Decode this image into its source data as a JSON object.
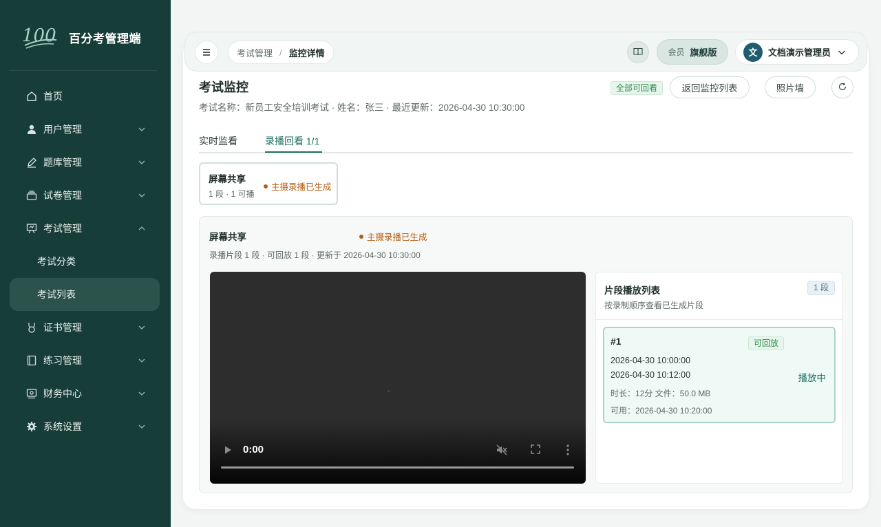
{
  "sidebar": {
    "brand": {
      "logo_text": "100",
      "name": "百分考管理端"
    },
    "items": [
      {
        "label": "首页",
        "icon": "home-icon"
      },
      {
        "label": "用户管理",
        "icon": "user-icon"
      },
      {
        "label": "题库管理",
        "icon": "pencil-icon"
      },
      {
        "label": "试卷管理",
        "icon": "stack-icon"
      },
      {
        "label": "考试管理",
        "icon": "presentation-icon"
      },
      {
        "label": "考试分类"
      },
      {
        "label": "考试列表"
      },
      {
        "label": "证书管理",
        "icon": "medal-icon"
      },
      {
        "label": "练习管理",
        "icon": "notebook-icon"
      },
      {
        "label": "财务中心",
        "icon": "finance-icon"
      },
      {
        "label": "系统设置",
        "icon": "gear-icon"
      }
    ]
  },
  "topbar": {
    "breadcrumb": [
      "考试管理",
      "/",
      "监控详情"
    ],
    "member_label": "会员",
    "member_plan": "旗舰版",
    "avatar_char": "文",
    "user_name": "文档演示管理员"
  },
  "page": {
    "title": "考试监控",
    "subtitle": "考试名称：新员工安全培训考试 · 姓名：张三 · 最近更新：2026-04-30 10:30:00",
    "badge": "全部可回看",
    "back_button": "返回监控列表",
    "photo_button": "照片墙"
  },
  "tabs": [
    {
      "label": "实时监看"
    },
    {
      "label": "录播回看 1/1"
    }
  ],
  "source_card": {
    "title": "屏幕共享",
    "sub": "1 段 · 1 可播",
    "status": "主摄录播已生成"
  },
  "detail": {
    "title": "屏幕共享",
    "status": "主摄录播已生成",
    "meta": "录播片段 1 段 · 可回放 1 段 · 更新于 2026-04-30 10:30:00",
    "video_time": "0:00"
  },
  "segments": {
    "title": "片段播放列表",
    "sub": "按录制顺序查看已生成片段",
    "count": "1 段",
    "items": [
      {
        "num": "#1",
        "badge": "可回放",
        "start": "2026-04-30 10:00:00",
        "end": "2026-04-30 10:12:00",
        "info": "时长：12分  文件：50.0 MB",
        "available": "可用：2026-04-30 10:20:00",
        "playing": "播放中"
      }
    ]
  },
  "colors": {
    "sidebar_bg": "#173d38",
    "accent": "#1f6f62",
    "status_orange": "#b55c12",
    "badge_green": "#2f8a4d"
  }
}
